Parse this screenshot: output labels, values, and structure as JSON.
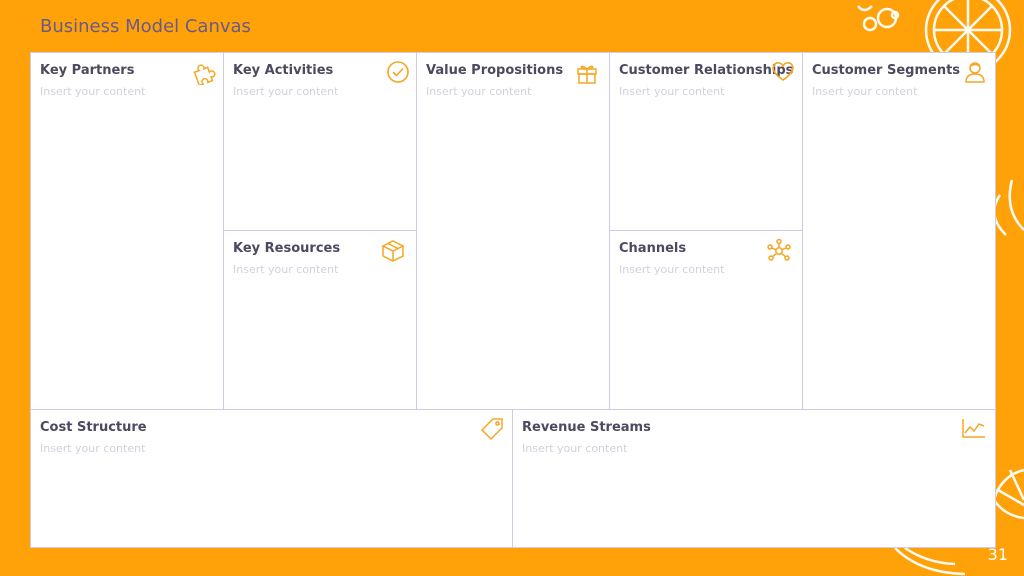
{
  "title": "Business Model Canvas",
  "page_number": "31",
  "placeholder": "Insert your content",
  "cells": {
    "key_partners": {
      "title": "Key Partners",
      "text": "Insert your content",
      "icon": "puzzle-icon"
    },
    "key_activities": {
      "title": "Key Activities",
      "text": "Insert your content",
      "icon": "check-circle-icon"
    },
    "key_resources": {
      "title": "Key Resources",
      "text": "Insert your content",
      "icon": "box-icon"
    },
    "value_propositions": {
      "title": "Value Propositions",
      "text": "Insert your content",
      "icon": "gift-icon"
    },
    "customer_relationships": {
      "title": "Customer Relationships",
      "text": "Insert your content",
      "icon": "heart-icon"
    },
    "channels": {
      "title": "Channels",
      "text": "Insert your content",
      "icon": "network-icon"
    },
    "customer_segments": {
      "title": "Customer Segments",
      "text": "Insert your content",
      "icon": "person-icon"
    },
    "cost_structure": {
      "title": "Cost Structure",
      "text": "Insert your content",
      "icon": "tag-icon"
    },
    "revenue_streams": {
      "title": "Revenue Streams",
      "text": "Insert your content",
      "icon": "line-chart-icon"
    }
  },
  "colors": {
    "background": "#FFA20A",
    "accent": "#F5A623",
    "border": "#CFCBE6",
    "title": "#6B5A86"
  }
}
